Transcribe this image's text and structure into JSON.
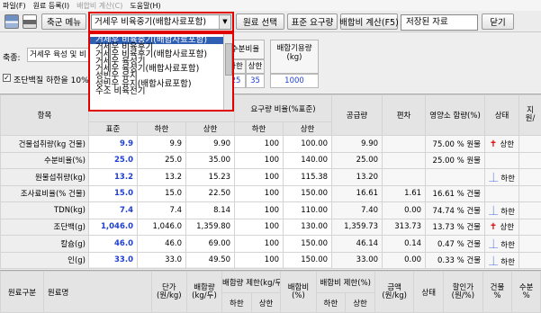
{
  "menu": [
    "파일(F)",
    "원료 등록(I)",
    "배합비 계산(C)",
    "도움말(H)"
  ],
  "toolbar": {
    "feed_menu_label": "축군 메뉴",
    "feed_select_value": "거세우 비육중기(배합사료포함)",
    "ingredient_select_label": "원료 선택",
    "standard_req_label": "표준 요구량",
    "calc_label": "배합비 계산(F5)",
    "saved_value": "저장된 자료",
    "close_label": "닫기"
  },
  "dropdown_options": [
    "거세우 비육중기(배합사료포함)",
    "거세우 비육후기",
    "거세우 비육후기(배합사료포함)",
    "거세우 육성기",
    "거세우 육성기(배합사료포함)",
    "성빈우 유지",
    "성빈우 유지(배합사료포함)",
    "수소 비육전기"
  ],
  "panel": {
    "species_label": "축종:",
    "species_value": "거세우 육성 및 비",
    "check_label": "조단백질 하한을 10%",
    "moisture_header": "수분비율(%)",
    "lower": "하한",
    "upper": "상한",
    "moist_low": "25",
    "moist_high": "35",
    "feed_header": "배합기용량\n(kg)",
    "feed_value": "1000"
  },
  "grid": {
    "headers": {
      "item": "항목",
      "std": "표준",
      "low": "하한",
      "high": "상한",
      "req_ratio": "요구량 비율(%표준)",
      "supply": "공급량",
      "dev": "편차",
      "content": "영양소 함량(%)",
      "status": "상태",
      "extra": "지\n원/"
    },
    "rows": [
      {
        "name": "건물섭취량(kg 건물)",
        "std": "9.9",
        "low": "9.9",
        "high": "9.90",
        "rlow": "100",
        "rhigh": "100.00",
        "supply": "9.90",
        "dev": "",
        "content": "75.00 % 원물",
        "dir": "up",
        "status": "상한"
      },
      {
        "name": "수분비율(%)",
        "std": "25.0",
        "low": "25.0",
        "high": "35.00",
        "rlow": "100",
        "rhigh": "140.00",
        "supply": "25.00",
        "dev": "",
        "content": "25.00 % 원물",
        "dir": "",
        "status": ""
      },
      {
        "name": "원물섭취량(kg)",
        "std": "13.2",
        "low": "13.2",
        "high": "15.23",
        "rlow": "100",
        "rhigh": "115.38",
        "supply": "13.20",
        "dev": "",
        "content": "",
        "dir": "down",
        "status": "하한"
      },
      {
        "name": "조사료비율(% 건물)",
        "std": "15.0",
        "low": "15.0",
        "high": "22.50",
        "rlow": "100",
        "rhigh": "150.00",
        "supply": "16.61",
        "dev": "1.61",
        "content": "16.61 % 건물",
        "dir": "",
        "status": ""
      },
      {
        "name": "TDN(kg)",
        "std": "7.4",
        "low": "7.4",
        "high": "8.14",
        "rlow": "100",
        "rhigh": "110.00",
        "supply": "7.40",
        "dev": "0.00",
        "content": "74.74 % 건물",
        "dir": "down",
        "status": "하한"
      },
      {
        "name": "조단백(g)",
        "std": "1,046.0",
        "low": "1,046.0",
        "high": "1,359.80",
        "rlow": "100",
        "rhigh": "130.00",
        "supply": "1,359.73",
        "dev": "313.73",
        "content": "13.73 % 건물",
        "dir": "up",
        "status": "상한"
      },
      {
        "name": "칼슘(g)",
        "std": "46.0",
        "low": "46.0",
        "high": "69.00",
        "rlow": "100",
        "rhigh": "150.00",
        "supply": "46.14",
        "dev": "0.14",
        "content": "0.47 % 건물",
        "dir": "down",
        "status": "하한"
      },
      {
        "name": "인(g)",
        "std": "33.0",
        "low": "33.0",
        "high": "49.50",
        "rlow": "100",
        "rhigh": "150.00",
        "supply": "33.00",
        "dev": "0.00",
        "content": "0.33 % 건물",
        "dir": "down",
        "status": "하한"
      }
    ]
  },
  "bottom": {
    "h1": "원료구분",
    "h2": "원료명",
    "h3": "단가\n(원/kg)",
    "h4": "배합량\n(kg/두)",
    "h5": "배합량 제한(kg/두)",
    "h6": "하한",
    "h7": "상한",
    "h8": "배합비\n(%)",
    "h9": "배합비 제한(%)",
    "h10": "하한",
    "h11": "상한",
    "h12": "금액\n(원/kg)",
    "h13": "상태",
    "h14": "할인가\n(원/%)",
    "h15": "건물\n%",
    "h16": "수분\n%"
  },
  "colors": {
    "highlight": "#e00000",
    "selected": "#2f5fb3",
    "up": "#e00000",
    "down": "#1040d0"
  }
}
